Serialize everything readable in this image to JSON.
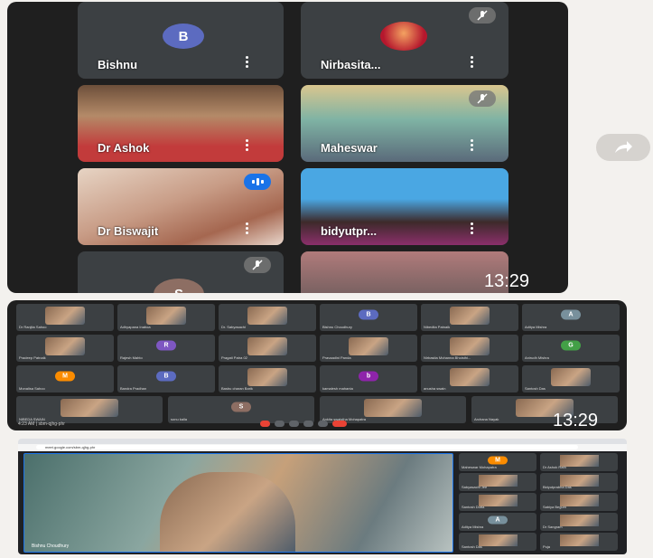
{
  "top": {
    "tiles": [
      {
        "name": "Bishnu",
        "avatar_letter": "B",
        "avatar_color": "#5c6bc0"
      },
      {
        "name": "Nirbasita...",
        "muted": true
      },
      {
        "name": "Dr Ashok"
      },
      {
        "name": "Maheswar",
        "muted": true
      },
      {
        "name": "Dr Biswajit",
        "speaking": true
      },
      {
        "name": "bidyutpr..."
      },
      {
        "name": "",
        "avatar_letter": "S",
        "avatar_color": "#8d6e63",
        "muted": true
      },
      {
        "name": ""
      }
    ],
    "clock": "13:29"
  },
  "middle": {
    "participants": [
      "Dr Ranjita Sahoo",
      "Adhyapana Inaboa",
      "Dr. Sabyasachi",
      "Bishnu Choudhury",
      "Nibedita Patnaik",
      "Aditya Mishra",
      "Pradeep Patnaik",
      "Rajesh Mahto",
      "Pragati Patra 02",
      "Pravaadini Panda",
      "Nirbasita Mohanna Bhoisthi...",
      "Anirudh Mishra",
      "Monalisa Sahoo",
      "Bandra Pradhan",
      "Basbu charan Barik",
      "kamalesh mahanta",
      "anusha swain",
      "Santosh Das",
      "NIBEDA SWAIN",
      "sonu kalla",
      "Ankita swaistha Mohapatra",
      "Archana Nayak"
    ],
    "avatars": {
      "B": "#5c6bc0",
      "A": "#78909c",
      "R": "#7e57c2",
      "M": "#fb8c00",
      "G": "#43a047",
      "b": "#8e24aa",
      "S": "#8d6e63"
    },
    "time_label": "4:23 AM",
    "meeting_code": "sbm-qjhg-phr",
    "clock": "13:29"
  },
  "bottom": {
    "url": "meet.google.com/sbm-qjhg-phr",
    "main_speaker": "Bishnu Choudhury",
    "side": [
      "Maheswar Mohapatra",
      "Dr Ashok Rath",
      "Sabyasachi Jee",
      "Bidyutprabha Das",
      "Santosh Dutta",
      "Sabiya Begum",
      "Aditya Mishra",
      "Dr Sangram",
      "Santosh Das",
      "Puja"
    ],
    "side_avatars": {
      "M": "#fb8c00",
      "A": "#78909c",
      "S": "#8d6e63"
    }
  }
}
